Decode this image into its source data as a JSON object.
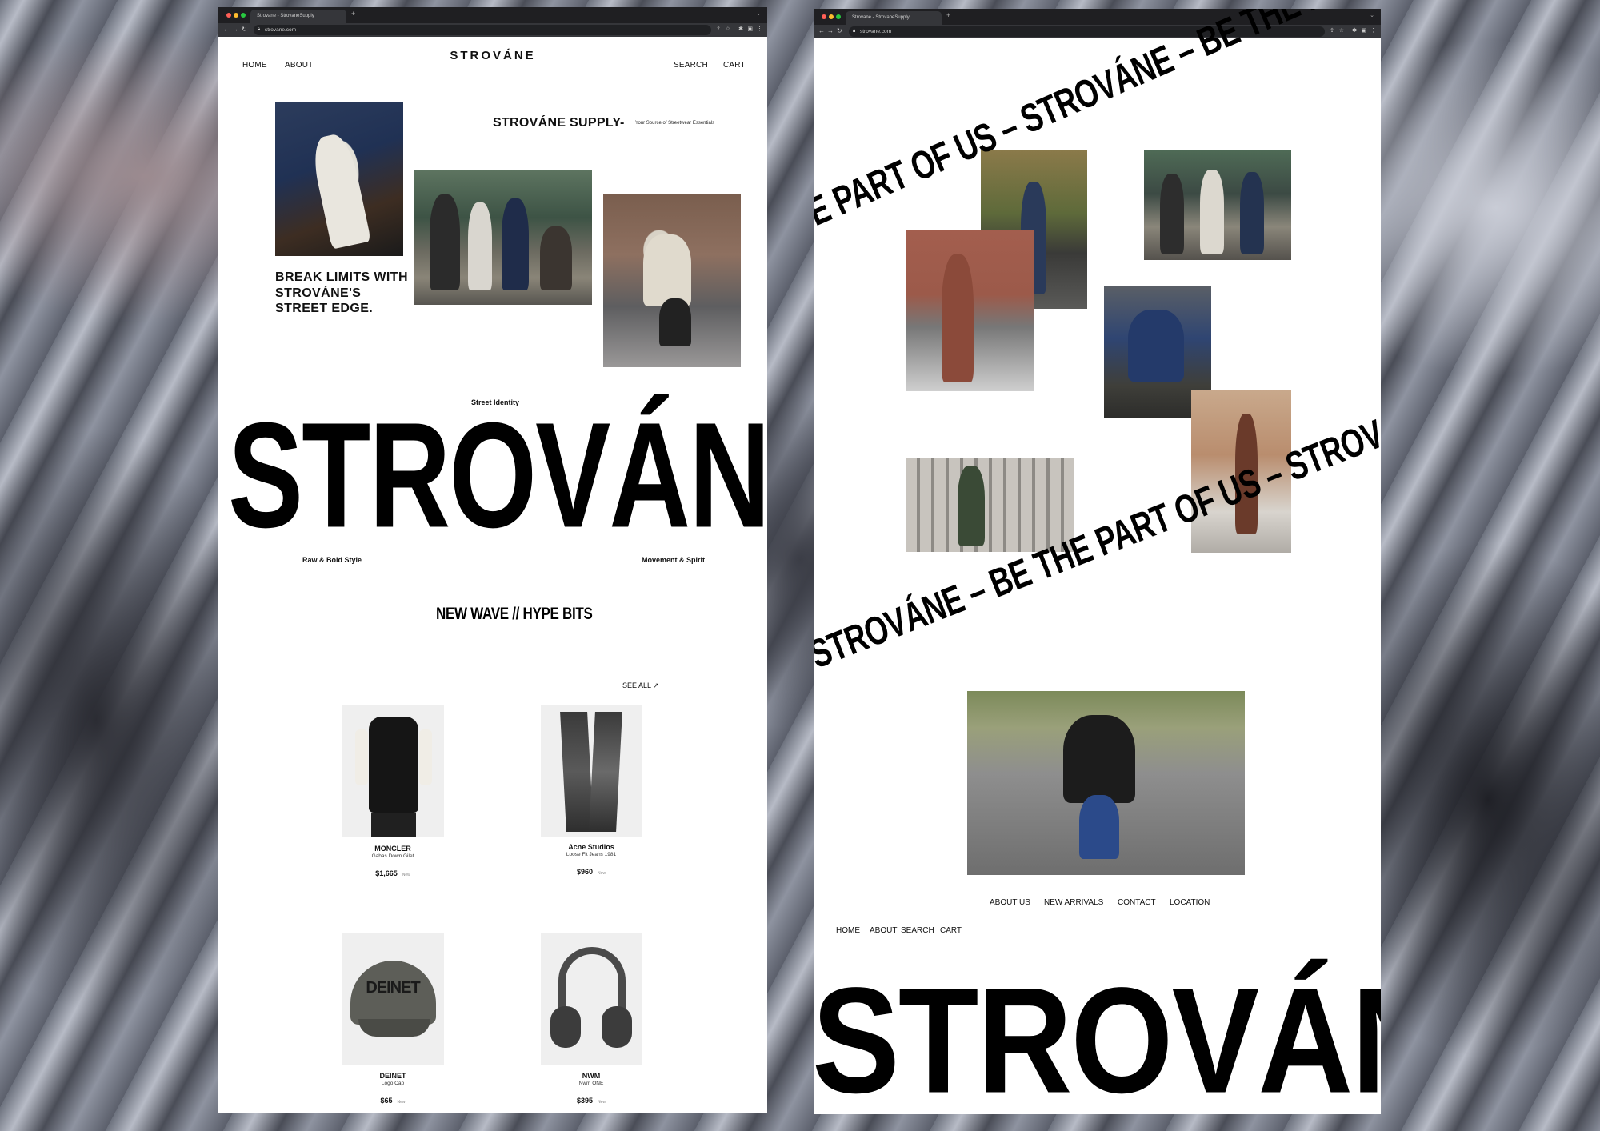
{
  "browser_left": {
    "tab_title": "Strovane - StrovaneSupply",
    "url": "strovane.com"
  },
  "browser_right": {
    "tab_title": "Strovane - StrovaneSupply",
    "url": "strovane.com"
  },
  "left": {
    "logo": "STROVÁNE",
    "nav": {
      "home": "HOME",
      "about": "ABOUT",
      "search": "SEARCH",
      "cart": "CART"
    },
    "supply_title": "STROVÁNE SUPPLY",
    "supply_dash": "-",
    "supply_sub": "Your Source of Streetwear Essentials",
    "headline_1": "BREAK LIMITS WITH",
    "headline_2": "STROVÁNE'S",
    "headline_3": "STREET EDGE.",
    "street_identity": "Street Identity",
    "giant_brand": "STROVÁNE",
    "raw_bold": "Raw & Bold Style",
    "movement": "Movement & Spirit",
    "section_title": "NEW WAVE // HYPE BITS",
    "see_all": "SEE ALL ↗",
    "products": [
      {
        "brand": "MONCLER",
        "name": "Gabas Down Gilet",
        "price": "$1,665",
        "tag": "New"
      },
      {
        "brand": "Acne Studios",
        "name": "Loose Fit Jeans 1981",
        "price": "$960",
        "tag": "New"
      },
      {
        "brand": "DEINET",
        "name": "Logo Cap",
        "price": "$65",
        "tag": "New",
        "print": "DEINET"
      },
      {
        "brand": "NWM",
        "name": "Nwm ONE",
        "price": "$395",
        "tag": "New"
      }
    ]
  },
  "right": {
    "ribbon_top": "E PART OF US – STROVÁNE – BE THE PART OF US – STROVÁNE – BE",
    "ribbon_bottom": "STROVÁNE – BE THE PART OF US – STROVÁNE – BE THE PART OF US",
    "footer_links": {
      "about_us": "ABOUT US",
      "new_arrivals": "NEW ARRIVALS",
      "contact": "CONTACT",
      "location": "LOCATION"
    },
    "footer_nav": {
      "home": "HOME",
      "about": "ABOUT",
      "search": "SEARCH",
      "cart": "CART"
    },
    "giant_brand": "STROVÁNE"
  },
  "colors": {
    "background_marble": "#6c707c",
    "page_bg": "#ffffff",
    "text": "#000000",
    "chrome_dark": "#1f1f22"
  },
  "icons": [
    "back-arrow-icon",
    "forward-arrow-icon",
    "reload-icon",
    "lock-icon",
    "share-icon",
    "star-icon",
    "extensions-icon",
    "sidebar-icon",
    "menu-dots-icon"
  ]
}
